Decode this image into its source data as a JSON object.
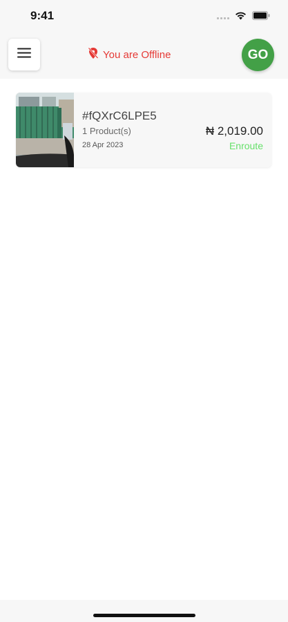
{
  "status_bar": {
    "time": "9:41",
    "signal_icon": "cellular-signal-icon",
    "wifi_icon": "wifi-icon",
    "battery_icon": "battery-icon"
  },
  "header": {
    "menu_icon": "hamburger-menu-icon",
    "offline_icon": "location-off-icon",
    "offline_text": "You are Offline",
    "go_label": "GO",
    "colors": {
      "offline": "#e53935",
      "go_button": "#43a047"
    }
  },
  "orders": [
    {
      "thumbnail": "storefront-photo",
      "id": "#fQXrC6LPE5",
      "products": "1 Product(s)",
      "date": "28 Apr 2023",
      "amount": "₦ 2,019.00",
      "status": "Enroute",
      "status_color": "#66e06a"
    }
  ]
}
